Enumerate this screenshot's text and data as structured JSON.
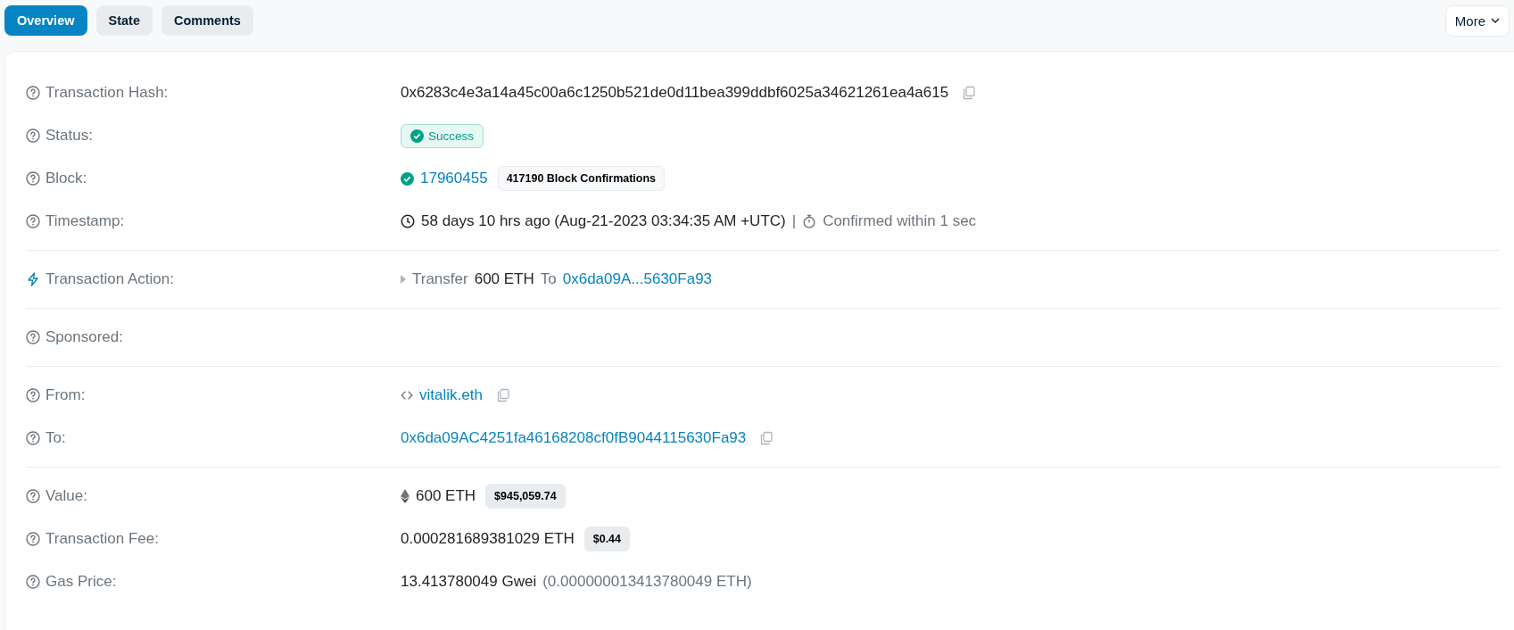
{
  "tabs": [
    {
      "label": "Overview",
      "selected": true
    },
    {
      "label": "State",
      "selected": false
    },
    {
      "label": "Comments",
      "selected": false
    }
  ],
  "more_button": {
    "label": "More"
  },
  "sections": [
    [
      {
        "kind": "hash",
        "label": "Transaction Hash:",
        "text": "0x6283c4e3a14a45c00a6c1250b521de0d11bea399ddbf6025a34621261ea4a615"
      },
      {
        "kind": "status",
        "label": "Status:",
        "badge": "Success"
      },
      {
        "kind": "block",
        "label": "Block:",
        "link": "17960455",
        "badge": "417190 Block Confirmations"
      },
      {
        "kind": "timestamp",
        "label": "Timestamp:",
        "text": "58 days 10 hrs ago (Aug-21-2023 03:34:35 AM +UTC)",
        "separator": "|",
        "note": "Confirmed within 1 sec"
      }
    ],
    [
      {
        "kind": "action",
        "label": "Transaction Action:",
        "verb": "Transfer",
        "amount": "600 ETH",
        "preposition": "To",
        "link": "0x6da09A...5630Fa93"
      }
    ],
    [
      {
        "kind": "empty",
        "label": "Sponsored:"
      }
    ],
    [
      {
        "kind": "name",
        "label": "From:",
        "link": "vitalik.eth"
      },
      {
        "kind": "address",
        "label": "To:",
        "link": "0x6da09AC4251fa46168208cf0fB9044115630Fa93"
      }
    ],
    [
      {
        "kind": "value",
        "label": "Value:",
        "text": "600 ETH",
        "badge": "$945,059.74"
      },
      {
        "kind": "fee",
        "label": "Transaction Fee:",
        "text": "0.000281689381029 ETH",
        "badge": "$0.44"
      },
      {
        "kind": "gas",
        "label": "Gas Price:",
        "text": "13.413780049 Gwei",
        "note": "(0.000000013413780049 ETH)"
      }
    ]
  ]
}
